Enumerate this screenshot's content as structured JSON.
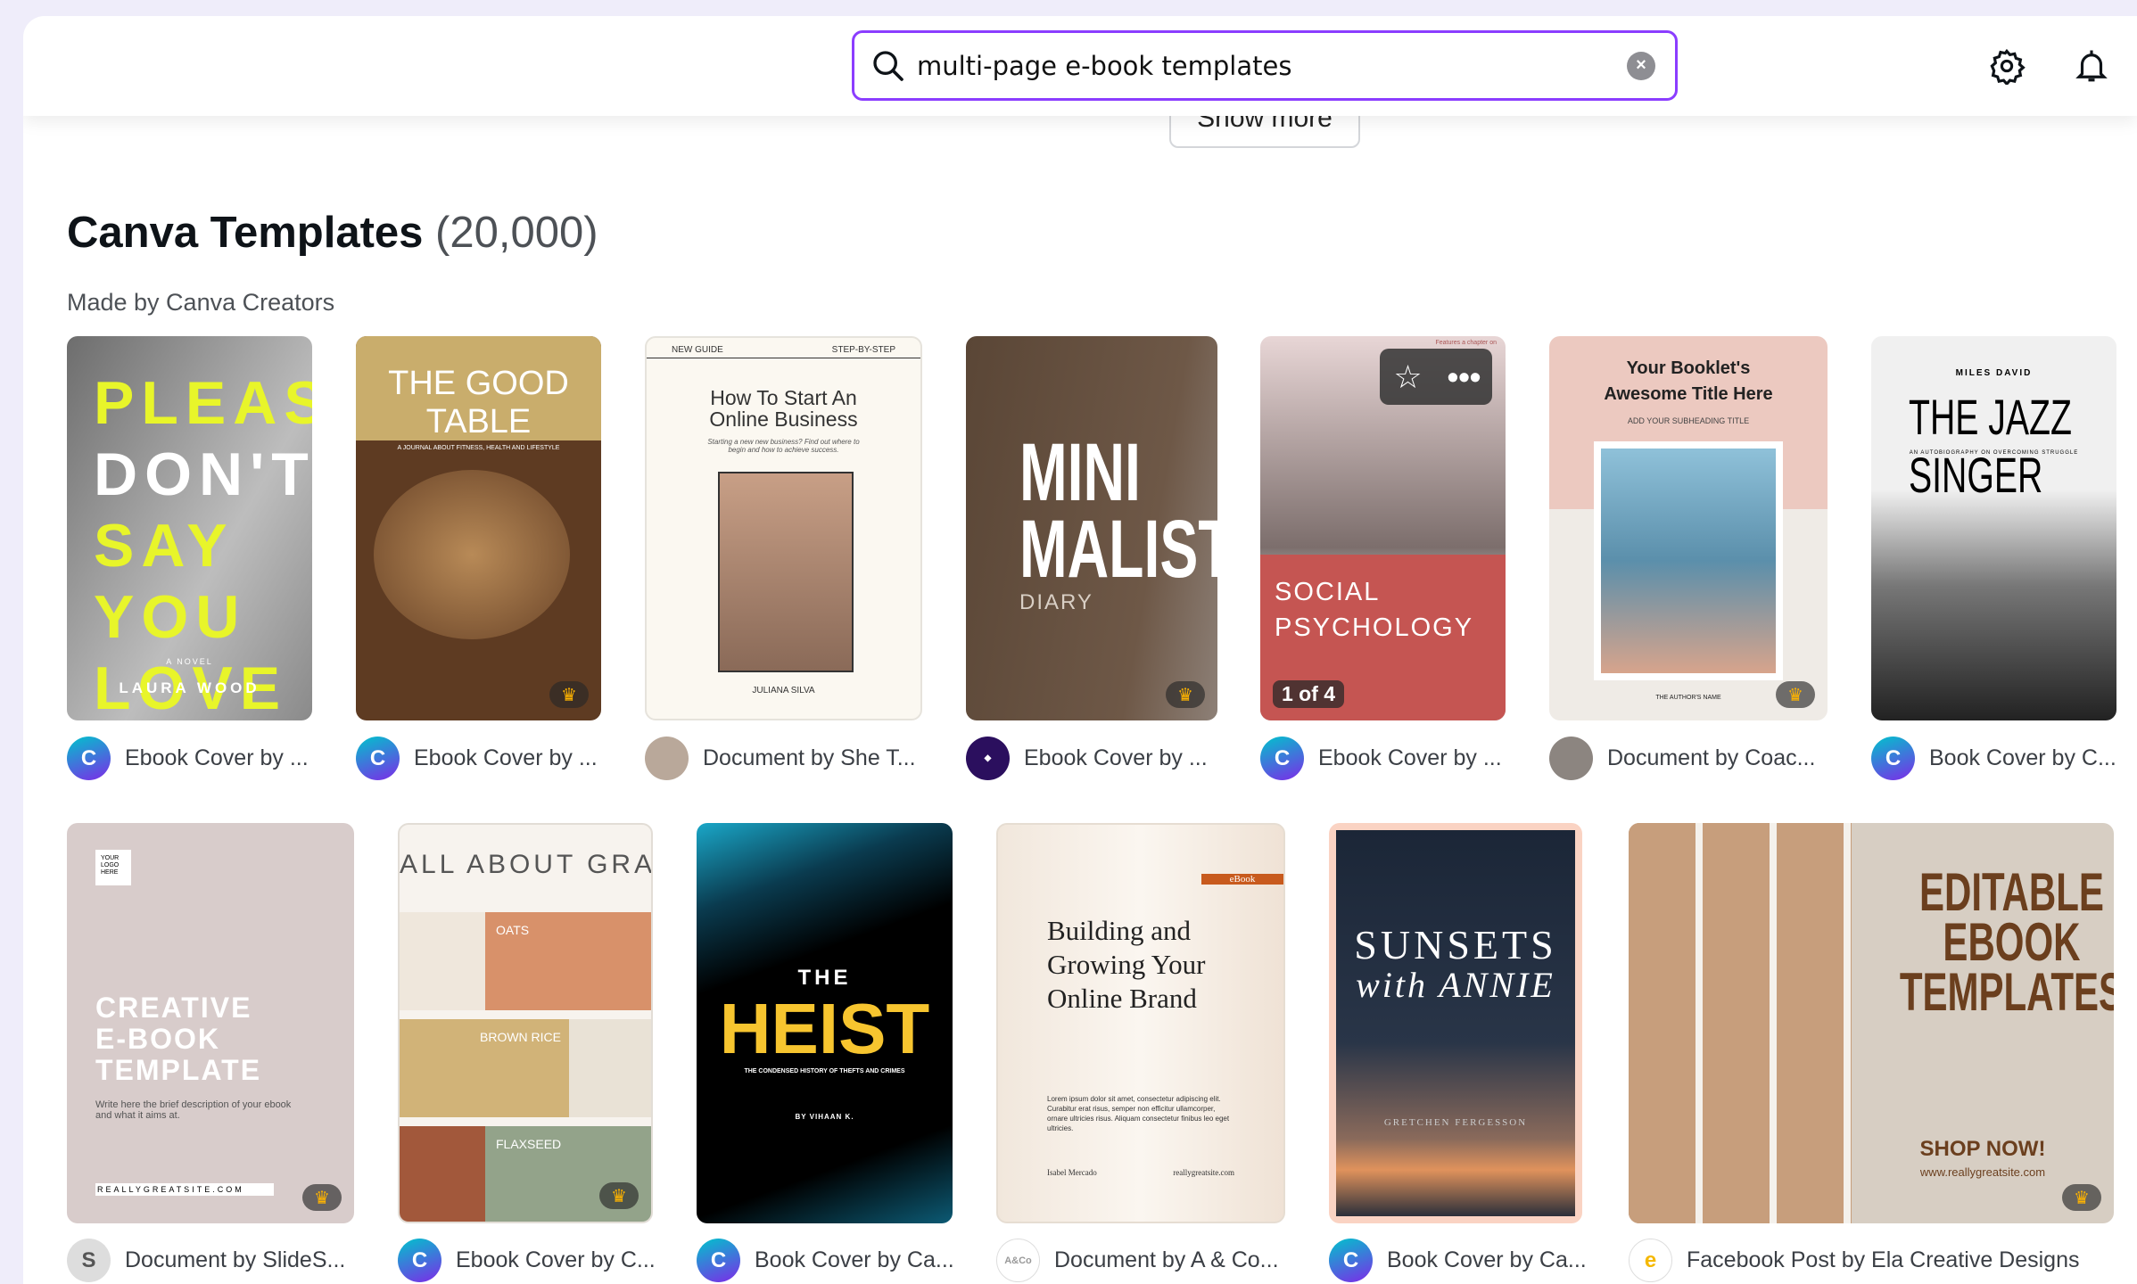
{
  "search": {
    "value": "multi-page e-book templates",
    "placeholder": "Search"
  },
  "header": {
    "settings_icon": "gear-icon",
    "notifications_icon": "bell-icon"
  },
  "show_more_label": "Show more",
  "section": {
    "title": "Canva Templates",
    "count": "(20,000)",
    "subtitle": "Made by Canva Creators"
  },
  "colors": {
    "accent": "#8b3dff",
    "premium": "#ffb400"
  },
  "row1": [
    {
      "caption": "Ebook Cover by ...",
      "lines": [
        "PLEASE",
        "DON'T",
        "SAY YOU",
        "LOVE ME"
      ],
      "small": "A NOVEL",
      "author": "LAURA WOOD"
    },
    {
      "caption": "Ebook Cover by ...",
      "heading": "THE GOOD TABLE",
      "small": "A JOURNAL ABOUT FITNESS, HEALTH AND LIFESTYLE",
      "premium": true
    },
    {
      "caption": "Document by She T...",
      "tag_left": "NEW GUIDE",
      "tag_right": "STEP-BY-STEP",
      "heading": "How To Start An Online Business",
      "small": "Starting a new new business? Find out where to begin and how to achieve success.",
      "author": "JULIANA SILVA"
    },
    {
      "caption": "Ebook Cover by ...",
      "heading": "MINI MALIST.",
      "small": "DIARY",
      "premium": true
    },
    {
      "caption": "Ebook Cover by ...",
      "heading": "SOCIAL PSYCHOLOGY",
      "page_badge": "1 of 4",
      "small": "Features a chapter on"
    },
    {
      "caption": "Document by Coac...",
      "heading": "Your Booklet's Awesome Title Here",
      "small": "ADD YOUR SUBHEADING TITLE",
      "author": "THE AUTHOR'S NAME",
      "premium": true
    },
    {
      "caption": "Book Cover by C...",
      "small": "MILES DAVID",
      "heading": "THE JAZZ SINGER",
      "sub": "AN AUTOBIOGRAPHY ON OVERCOMING STRUGGLE"
    }
  ],
  "row2": [
    {
      "caption": "Document by SlideS...",
      "logo": "YOUR LOGO HERE",
      "heading": "CREATIVE E-BOOK TEMPLATE",
      "small": "Write here the brief description of your ebook and what it aims at.",
      "url": "REALLYGREATSITE.COM",
      "premium": true
    },
    {
      "caption": "Ebook Cover by C...",
      "heading": "ALL ABOUT GRAINS",
      "items": [
        "OATS",
        "BROWN RICE",
        "FLAXSEED"
      ],
      "premium": true
    },
    {
      "caption": "Book Cover by Ca...",
      "small": "THE",
      "heading": "HEIST",
      "sub": "THE CONDENSED HISTORY OF THEFTS AND CRIMES",
      "author": "BY VIHAAN K."
    },
    {
      "caption": "Document by A & Co...",
      "tag": "eBook",
      "heading": "Building and Growing Your Online Brand",
      "small": "Lorem ipsum dolor sit amet, consectetur adipiscing elit. Curabitur erat risus, semper non efficitur ullamcorper, ornare ultricies risus. Aliquam consectetur finibus leo eget ultricies.",
      "author": "Isabel Mercado",
      "url": "reallygreatsite.com"
    },
    {
      "caption": "Book Cover by Ca...",
      "heading": "SUNSETS",
      "sub": "with ANNIE",
      "author": "GRETCHEN FERGESSON"
    },
    {
      "caption": "Facebook Post by Ela Creative Designs",
      "heading": "EDITABLE EBOOK TEMPLATES",
      "small": "SHOP NOW!",
      "url": "www.reallygreatsite.com",
      "premium": true
    }
  ]
}
